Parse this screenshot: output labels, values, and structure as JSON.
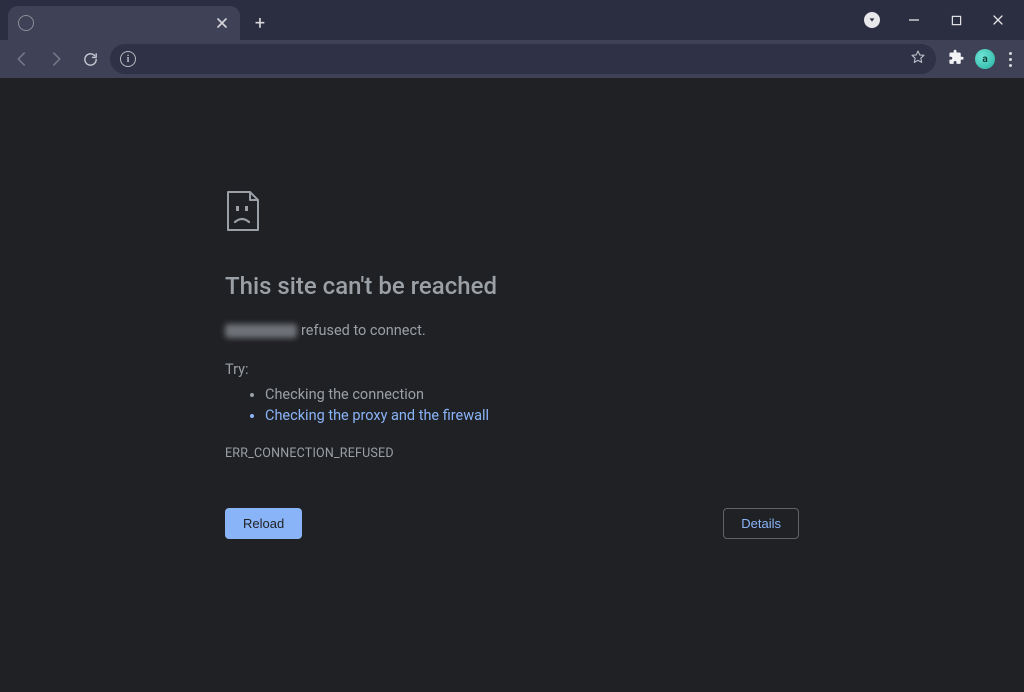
{
  "tab": {
    "title": "",
    "favicon": "globe-icon"
  },
  "omnibox": {
    "url": "",
    "info_tooltip": "View site information"
  },
  "error": {
    "heading": "This site can't be reached",
    "refused_suffix": "refused to connect.",
    "try_label": "Try:",
    "suggestions": [
      "Checking the connection",
      "Checking the proxy and the firewall"
    ],
    "code": "ERR_CONNECTION_REFUSED"
  },
  "buttons": {
    "reload": "Reload",
    "details": "Details"
  },
  "avatar_initial": "a"
}
